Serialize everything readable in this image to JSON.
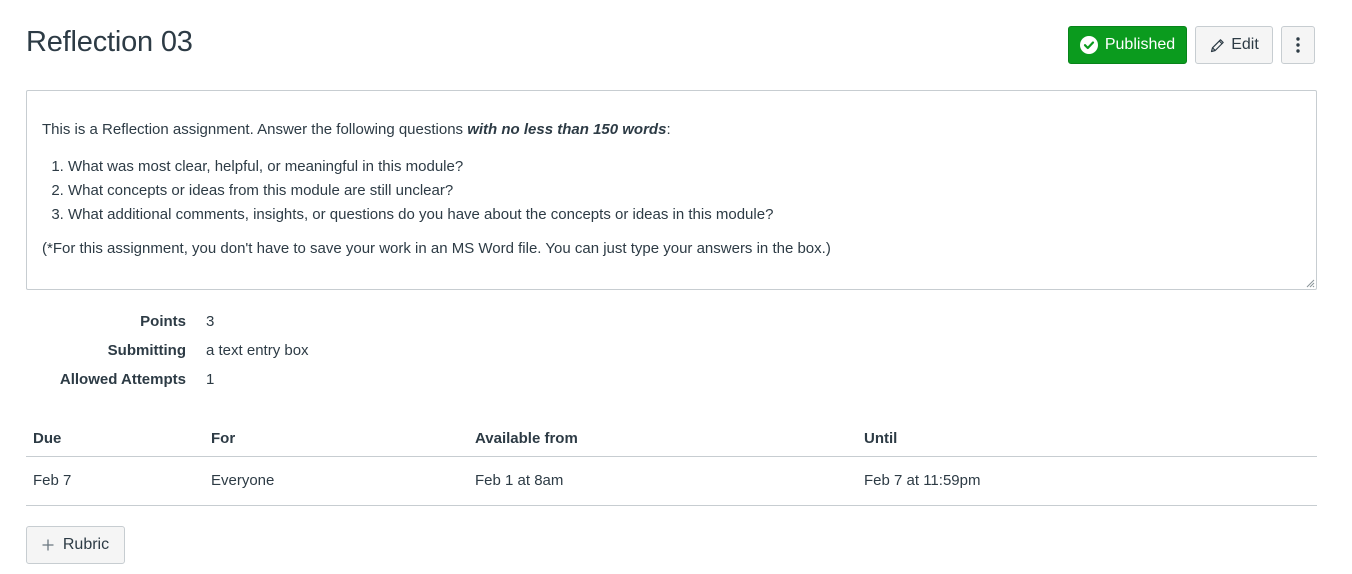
{
  "page": {
    "title": "Reflection 03"
  },
  "header_actions": {
    "published_label": "Published",
    "edit_label": "Edit",
    "more_icon": "kebab-vertical-icon"
  },
  "description": {
    "intro_text": "This is a Reflection assignment. Answer the following questions ",
    "intro_emphasis": "with no less than 150 words",
    "intro_end": ":",
    "questions": [
      "What was most clear, helpful, or meaningful in this module?",
      "What concepts or ideas from this module are still unclear?",
      "What additional comments, insights, or questions do you have about the concepts or ideas in this module?"
    ],
    "note": "(*For this assignment, you don't have to save your work in an MS Word file. You can just type your answers in the box.)"
  },
  "details": [
    {
      "label": "Points",
      "value": "3"
    },
    {
      "label": "Submitting",
      "value": "a text entry box"
    },
    {
      "label": "Allowed Attempts",
      "value": "1"
    }
  ],
  "dates_table": {
    "headers": [
      "Due",
      "For",
      "Available from",
      "Until"
    ],
    "rows": [
      [
        "Feb 7",
        "Everyone",
        "Feb 1 at 8am",
        "Feb 7 at 11:59pm"
      ]
    ]
  },
  "rubric": {
    "button_label": "Rubric"
  },
  "colors": {
    "published_green": "#0b9b1e",
    "text": "#2d3b45",
    "border": "#c7cdd1",
    "button_bg": "#f5f5f5"
  }
}
